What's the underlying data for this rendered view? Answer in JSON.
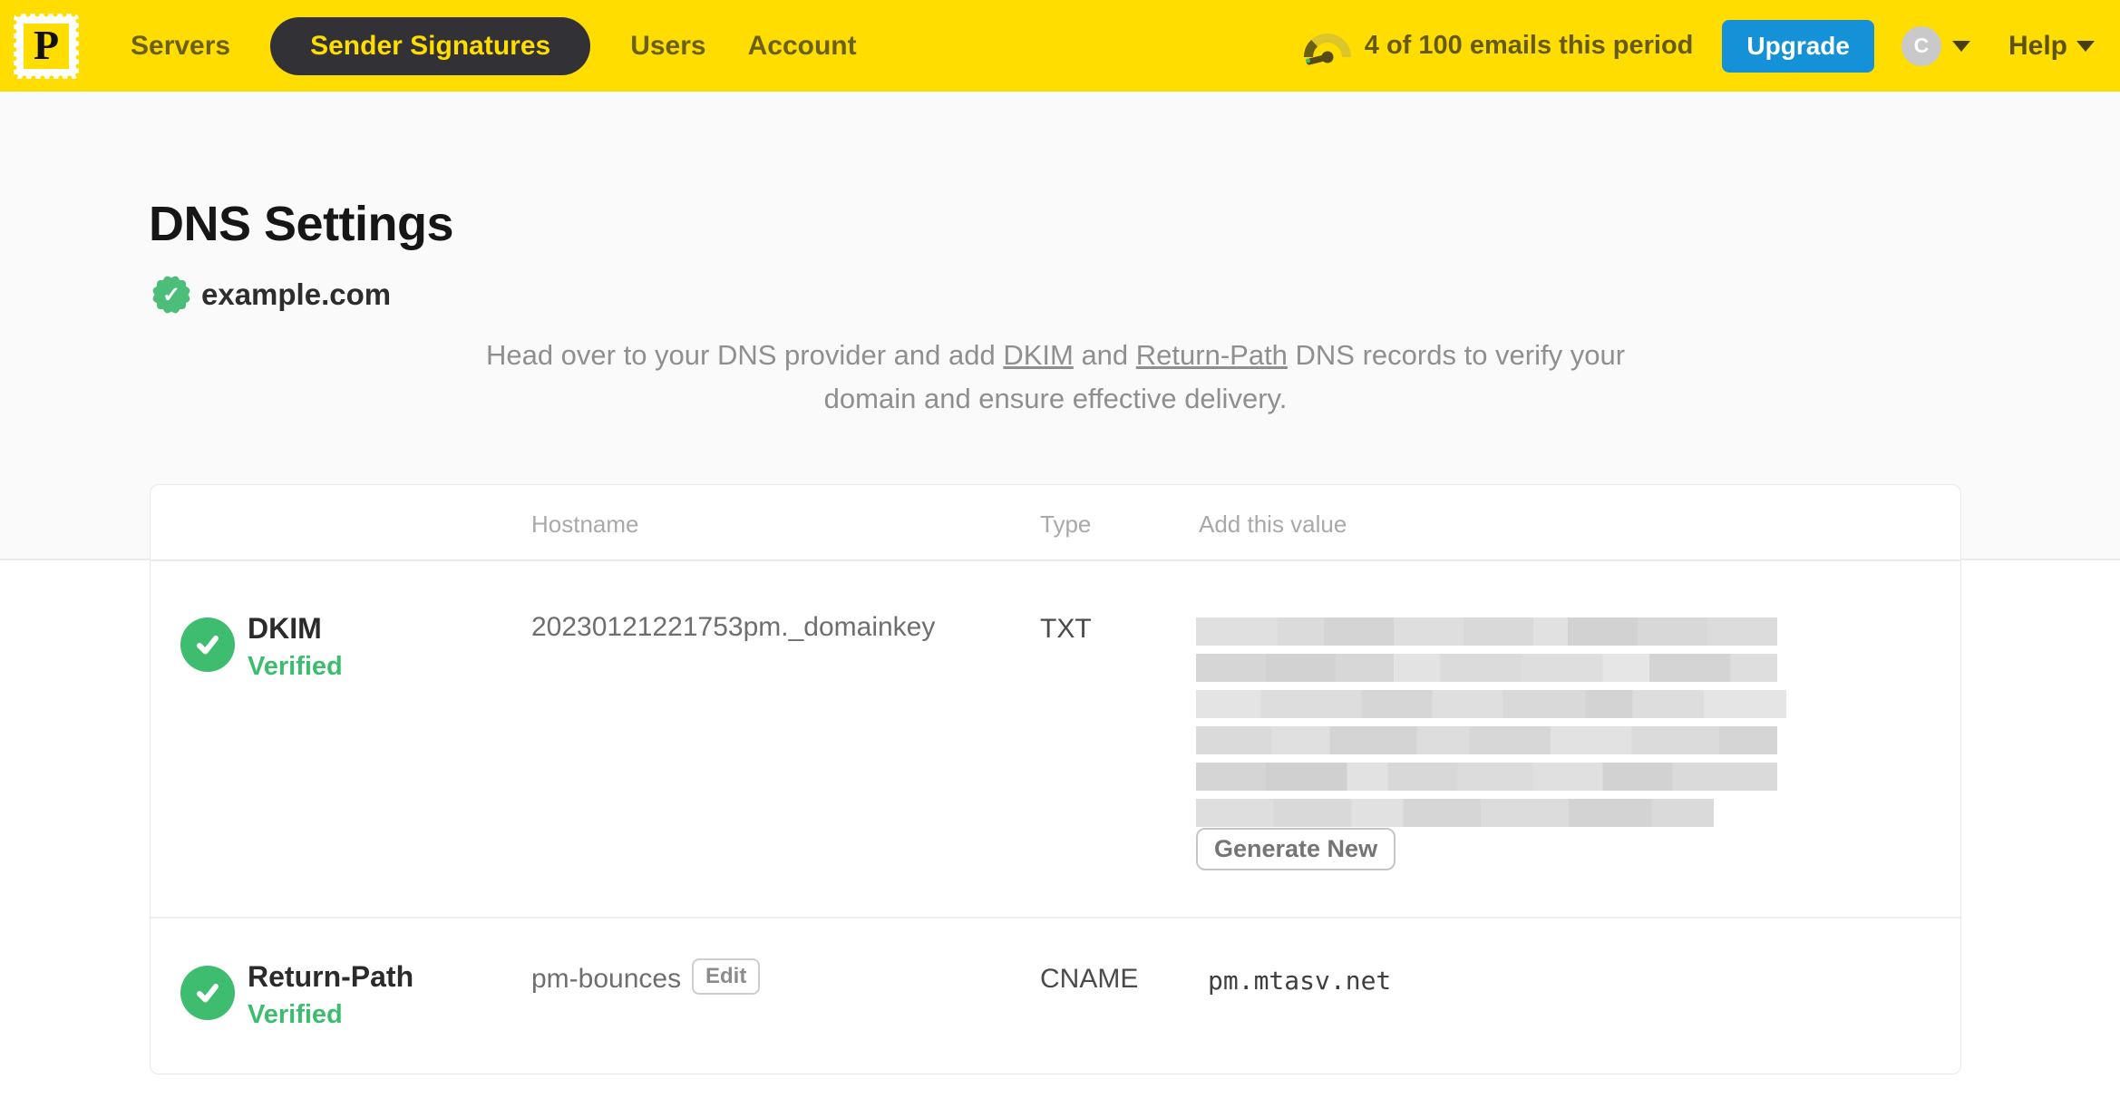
{
  "nav": {
    "logo_letter": "P",
    "items": [
      {
        "label": "Servers",
        "active": false
      },
      {
        "label": "Sender Signatures",
        "active": true
      },
      {
        "label": "Users",
        "active": false
      },
      {
        "label": "Account",
        "active": false
      }
    ],
    "usage_text": "4 of 100 emails this period",
    "upgrade_label": "Upgrade",
    "avatar_initial": "C",
    "help_label": "Help"
  },
  "hero": {
    "title": "DNS Settings",
    "domain": "example.com",
    "description": {
      "prefix": "Head over to your DNS provider and add ",
      "link_dkim": "DKIM",
      "middle": " and ",
      "link_return_path": "Return-Path",
      "suffix": " DNS records to verify your domain and ensure effective delivery."
    }
  },
  "table": {
    "headers": {
      "hostname": "Hostname",
      "type": "Type",
      "value": "Add this value"
    },
    "rows": [
      {
        "name": "DKIM",
        "status": "Verified",
        "hostname": "20230121221753pm._domainkey",
        "type": "TXT",
        "value_redacted": true,
        "action_label": "Generate New"
      },
      {
        "name": "Return-Path",
        "status": "Verified",
        "hostname": "pm-bounces",
        "hostname_action_label": "Edit",
        "type": "CNAME",
        "value": "pm.mtasv.net"
      }
    ]
  },
  "colors": {
    "brand_yellow": "#FFDD00",
    "nav_pill_dark": "#313136",
    "upgrade_blue": "#1591D8",
    "verified_green": "#3EBD71",
    "seal_green": "#4CBE79",
    "hero_background": "#FAFAFA"
  }
}
